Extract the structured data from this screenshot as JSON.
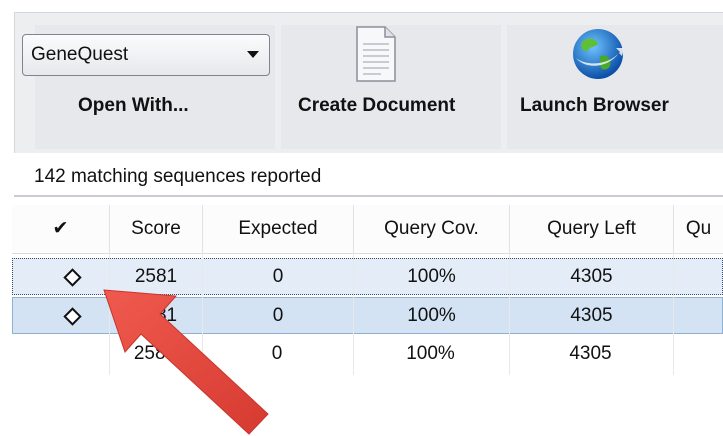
{
  "toolbar": {
    "open_with_select_value": "GeneQuest",
    "open_with_label": "Open With...",
    "create_document_label": "Create Document",
    "launch_browser_label": "Launch Browser",
    "icons": [
      "document-icon",
      "globe-icon",
      "chevron-down-icon"
    ]
  },
  "status": {
    "text": "142 matching sequences reported"
  },
  "table": {
    "columns": [
      "✔",
      "Score",
      "Expected",
      "Query Cov.",
      "Query Left",
      "Qu"
    ],
    "rows": [
      {
        "marker": "diamond",
        "score": "2581",
        "expected": "0",
        "query_cov": "100%",
        "query_left": "4305",
        "selected": true,
        "focused": true
      },
      {
        "marker": "diamond",
        "score": "2581",
        "expected": "0",
        "query_cov": "100%",
        "query_left": "4305",
        "selected": true,
        "focused": false
      },
      {
        "marker": "",
        "score": "2581",
        "expected": "0",
        "query_cov": "100%",
        "query_left": "4305",
        "selected": false,
        "focused": false
      }
    ]
  },
  "annotation": {
    "type": "arrow",
    "color": "#e8473f"
  }
}
